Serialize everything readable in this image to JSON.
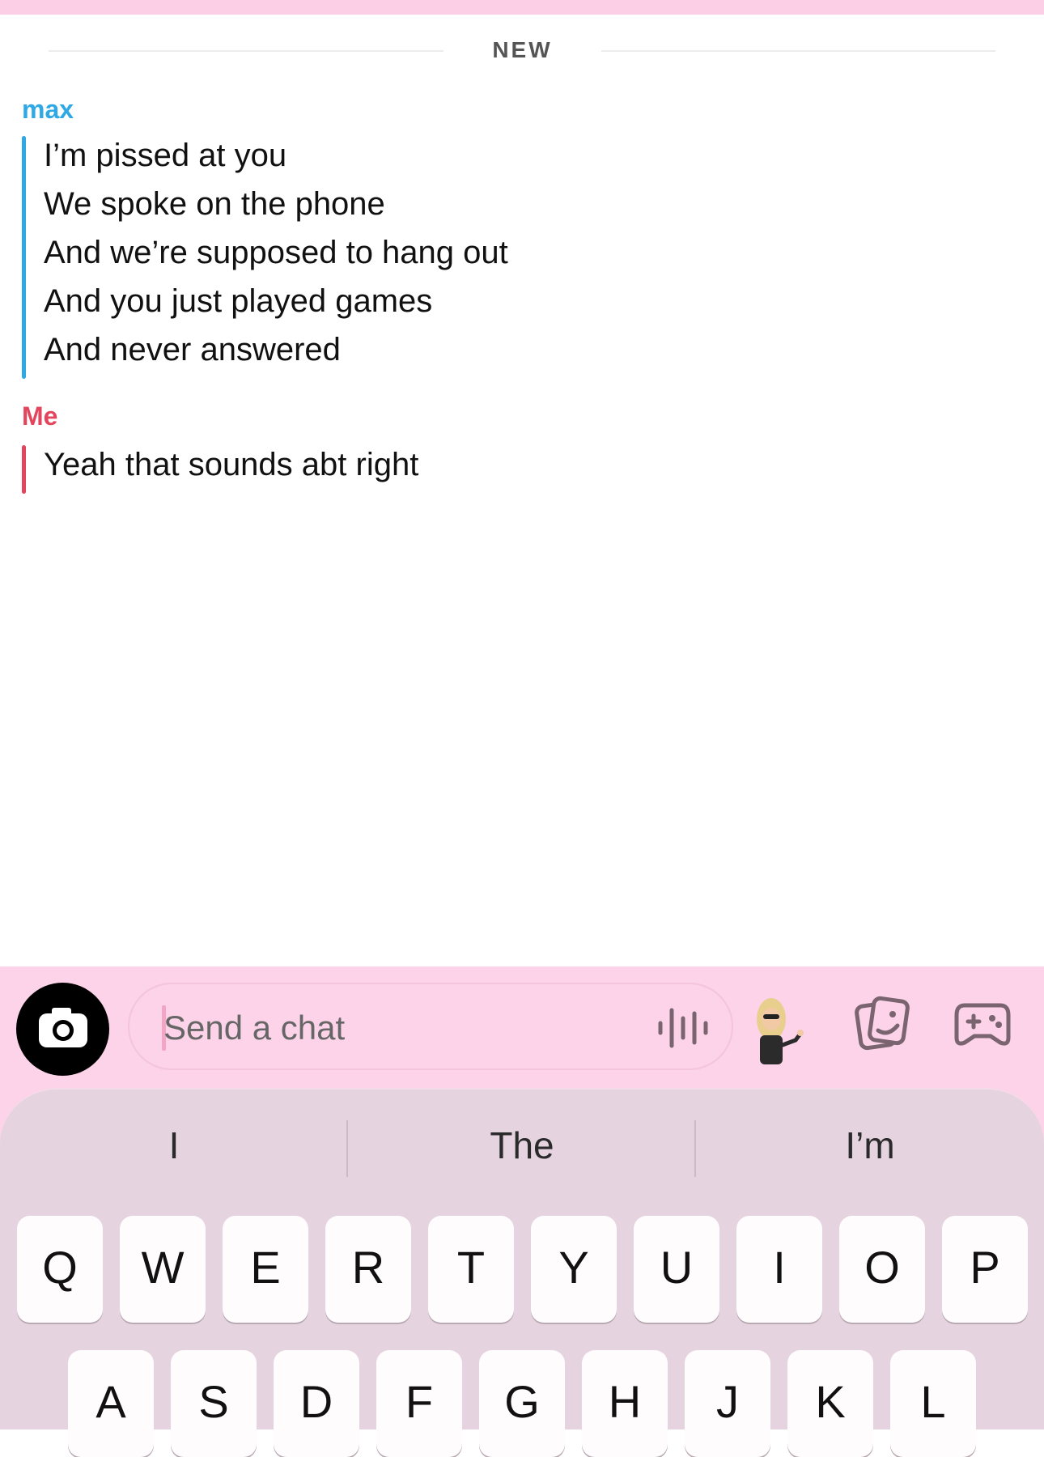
{
  "divider": {
    "label": "NEW"
  },
  "messages": [
    {
      "sender": "max",
      "lines": [
        "I’m pissed at you",
        "We spoke on the phone",
        "And we’re supposed to hang out",
        "And you just played games",
        "And never answered"
      ]
    },
    {
      "sender": "Me",
      "lines": [
        "Yeah that sounds abt right"
      ]
    }
  ],
  "composer": {
    "placeholder": "Send a chat",
    "icons": [
      "camera-icon",
      "voice-waveform-icon",
      "bitmoji-avatar",
      "sticker-icon",
      "game-controller-icon"
    ]
  },
  "keyboard": {
    "suggestions": [
      "I",
      "The",
      "I’m"
    ],
    "row1": [
      "Q",
      "W",
      "E",
      "R",
      "T",
      "Y",
      "U",
      "I",
      "O",
      "P"
    ],
    "row2_partial": [
      "A",
      "S",
      "D",
      "F",
      "G",
      "H",
      "J",
      "K",
      "L"
    ]
  },
  "colors": {
    "top_bar": "#fccfe6",
    "max_accent": "#2fa8e6",
    "me_accent": "#e4455c",
    "keyboard_bg": "#e6d3e0"
  }
}
